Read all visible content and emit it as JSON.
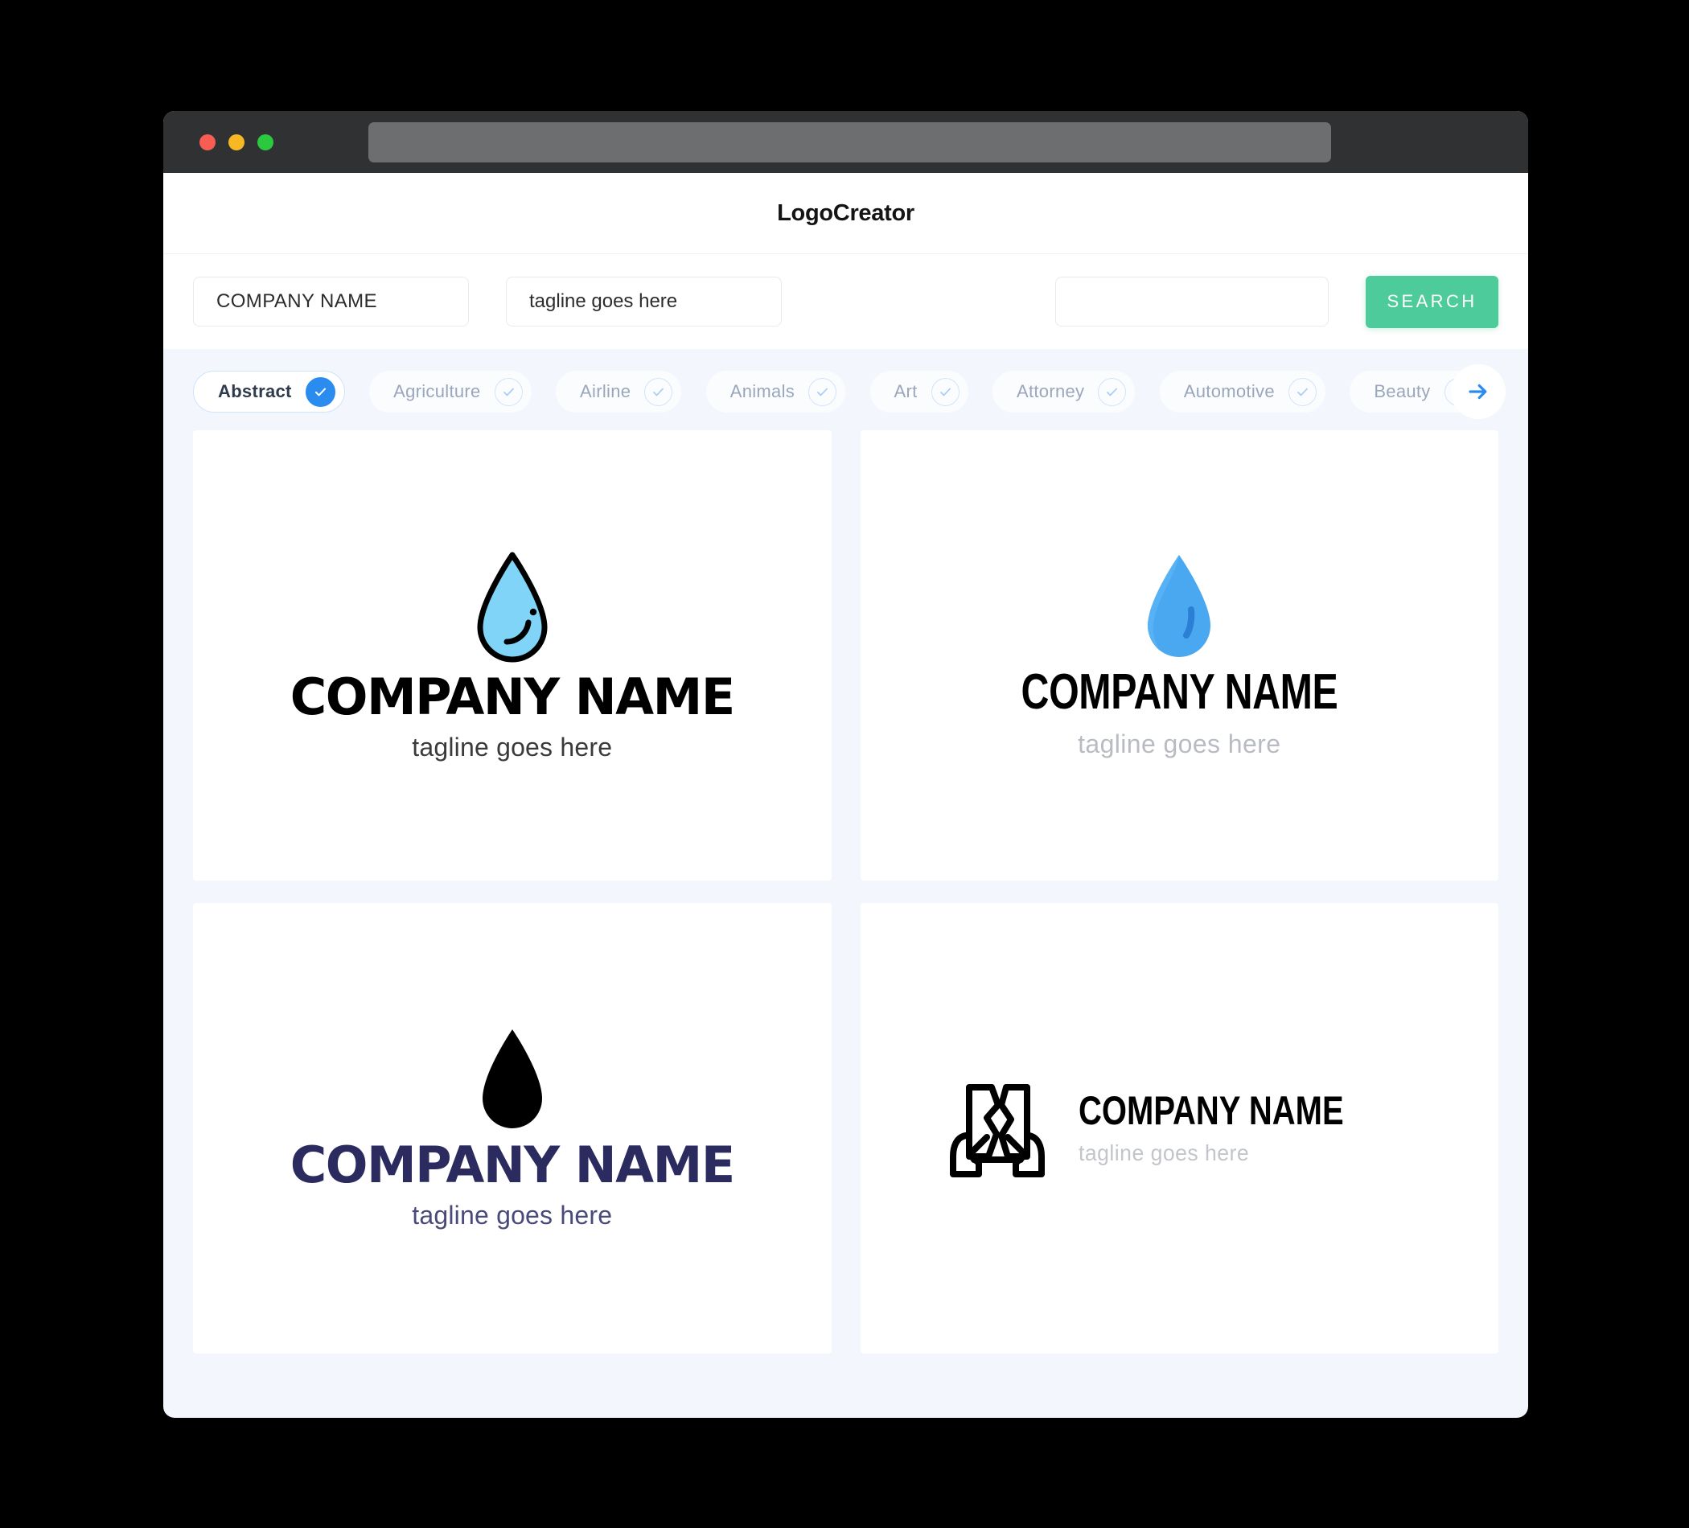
{
  "window": {
    "traffic_lights": [
      "close",
      "minimize",
      "maximize"
    ],
    "url_value": ""
  },
  "header": {
    "title": "LogoCreator"
  },
  "search": {
    "company_value": "COMPANY NAME",
    "company_placeholder": "COMPANY NAME",
    "tagline_value": "tagline goes here",
    "tagline_placeholder": "tagline goes here",
    "extra_value": "",
    "extra_placeholder": "",
    "button_label": "SEARCH",
    "button_color": "#4ecb9a"
  },
  "categories": {
    "next_arrow_icon": "arrow-right-icon",
    "active_index": 0,
    "items": [
      {
        "label": "Abstract",
        "selected": true
      },
      {
        "label": "Agriculture",
        "selected": false
      },
      {
        "label": "Airline",
        "selected": false
      },
      {
        "label": "Animals",
        "selected": false
      },
      {
        "label": "Art",
        "selected": false
      },
      {
        "label": "Attorney",
        "selected": false
      },
      {
        "label": "Automotive",
        "selected": false
      },
      {
        "label": "Beauty",
        "selected": false
      }
    ]
  },
  "logos": [
    {
      "icon": "water-drop-outline-icon",
      "name": "COMPANY NAME",
      "tagline": "tagline goes here",
      "name_color": "#000000",
      "tagline_color": "#3a3a3a",
      "icon_fill": "#7fd4f7",
      "icon_stroke": "#000000",
      "layout": "stacked"
    },
    {
      "icon": "water-drop-solid-icon",
      "name": "COMPANY NAME",
      "tagline": "tagline goes here",
      "name_color": "#000000",
      "tagline_color": "#b8bcc2",
      "icon_fill": "#4aa8f0",
      "icon_stroke": "#2b7fd4",
      "layout": "stacked"
    },
    {
      "icon": "water-drop-black-icon",
      "name": "COMPANY NAME",
      "tagline": "tagline goes here",
      "name_color": "#2b2b5f",
      "tagline_color": "#4a4a7a",
      "icon_fill": "#000000",
      "icon_stroke": "#000000",
      "layout": "stacked"
    },
    {
      "icon": "hands-holding-cracked-pillar-icon",
      "name": "COMPANY NAME",
      "tagline": "tagline goes here",
      "name_color": "#000000",
      "tagline_color": "#c2c5ca",
      "icon_fill": "none",
      "icon_stroke": "#000000",
      "layout": "horizontal"
    }
  ],
  "theme": {
    "page_bg": "#000000",
    "app_bg": "#f3f6fd",
    "card_bg": "#ffffff",
    "titlebar_bg": "#2f3133",
    "urlbar_bg": "#6d6e70",
    "accent_green": "#4ecb9a",
    "accent_blue": "#2b8cf0"
  }
}
